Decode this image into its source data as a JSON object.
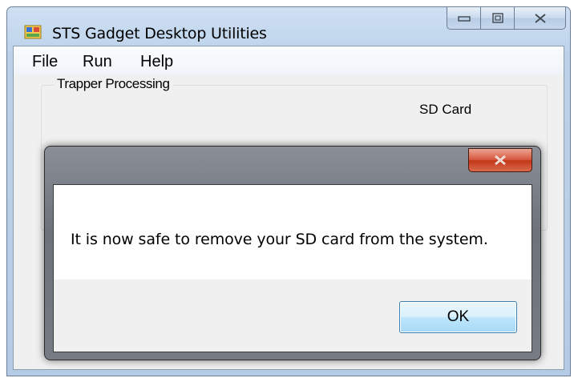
{
  "window": {
    "title": "STS Gadget Desktop Utilities",
    "icons": {
      "app": "app-icon",
      "minimize": "minimize-icon",
      "maximize": "maximize-icon",
      "close": "close-icon"
    }
  },
  "menu": {
    "items": [
      {
        "label": "File"
      },
      {
        "label": "Run"
      },
      {
        "label": "Help"
      }
    ]
  },
  "main": {
    "group_label": "Trapper Processing",
    "sd_card_label": "SD Card"
  },
  "dialog": {
    "message": "It is now safe to remove your SD card from the system.",
    "ok_label": "OK",
    "close_icon": "close-icon"
  },
  "colors": {
    "dialog_close": "#c94a2c",
    "ok_border": "#3c7fb1",
    "title_bar": "#c3d7ee"
  }
}
